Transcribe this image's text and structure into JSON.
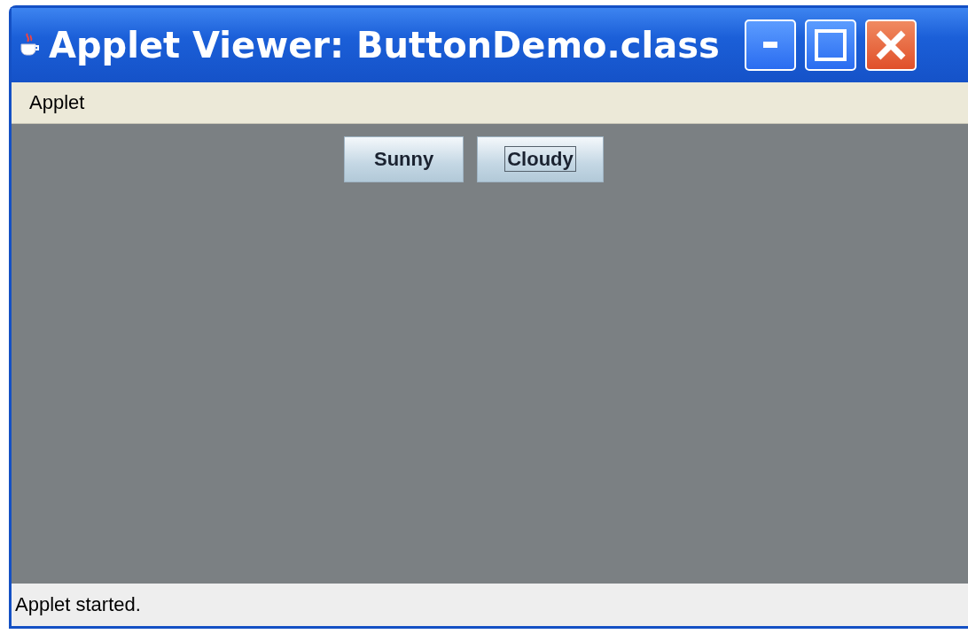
{
  "window": {
    "title": "Applet Viewer: ButtonDemo.class"
  },
  "menu_bar": [
    "Applet"
  ],
  "buttons": [
    {
      "label": "Sunny",
      "focused": false
    },
    {
      "label": "Cloudy",
      "focused": true
    }
  ],
  "status_bar": "Applet started."
}
